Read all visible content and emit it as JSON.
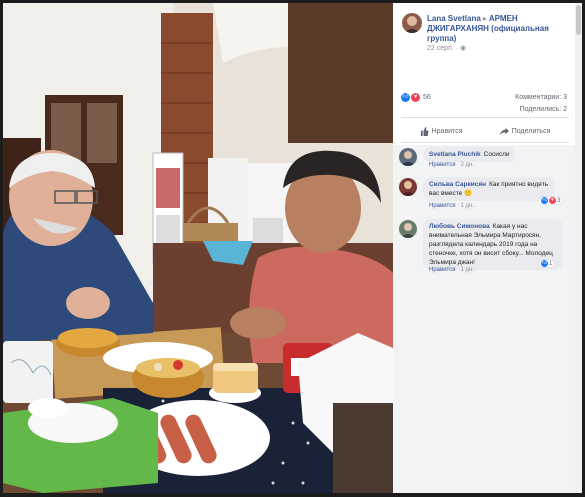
{
  "post": {
    "author": "Lana Svetlana",
    "group": "АРМЕН ДЖИГАРХАНЯН (официальная группа)",
    "date": "22 серп.",
    "reactions_count": "56",
    "comments_label": "Комментарии: 3",
    "shares_label": "Поделились: 2"
  },
  "actions": {
    "like_label": "Нравится",
    "share_label": "Поделиться"
  },
  "comments": [
    {
      "author": "Svetlana Pluchik",
      "text": "Сосисли",
      "like_label": "Нравится",
      "time": "2 дн."
    },
    {
      "author": "Сильва Саркисян",
      "text": "Как приятно видеть вас вместе",
      "like_label": "Нравится",
      "time": "1 дн.",
      "reactions": "3"
    },
    {
      "author": "Любовь Симонова",
      "text": "Какая у нас внимательная Эльмира Мартиросян, разглядела календарь 2019 года на стеночке, хотя он висит сбоку... Молодец Эльмира джан!",
      "like_label": "Нравится",
      "time": "1 дн.",
      "reactions": "1"
    }
  ],
  "colors": {
    "link": "#365899",
    "like": "#1877f2",
    "love": "#f33e58",
    "panel_bg": "#ffffff",
    "comments_bg": "#f2f3f5"
  },
  "icons": {
    "like": "thumbs-up-icon",
    "share": "share-arrow-icon"
  }
}
